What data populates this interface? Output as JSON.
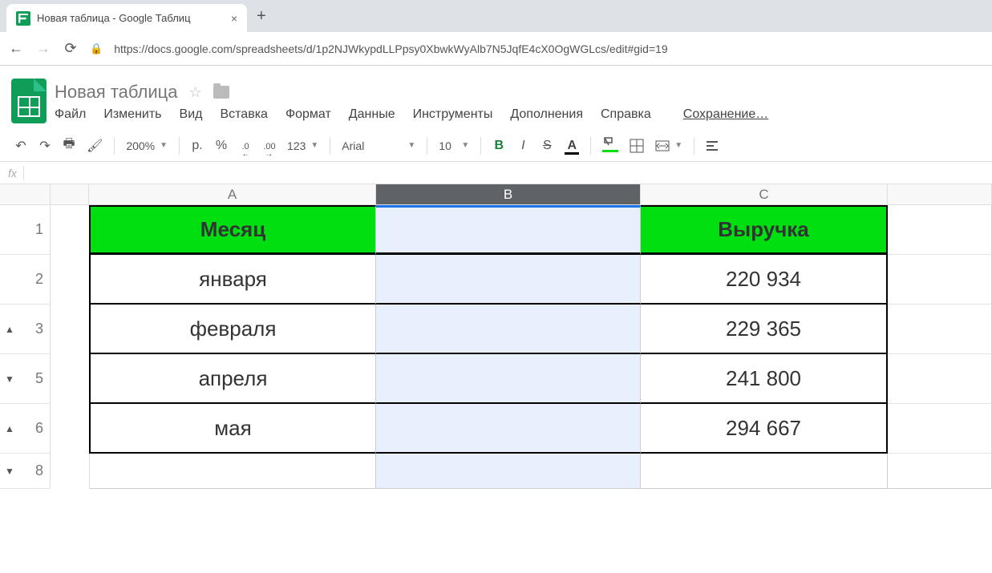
{
  "browser": {
    "tab_title": "Новая таблица - Google Таблиц",
    "url": "https://docs.google.com/spreadsheets/d/1p2NJWkypdLLPpsy0XbwkWyAlb7N5JqfE4cX0OgWGLcs/edit#gid=19"
  },
  "doc": {
    "title": "Новая таблица",
    "status": "Сохранение…"
  },
  "menus": [
    "Файл",
    "Изменить",
    "Вид",
    "Вставка",
    "Формат",
    "Данные",
    "Инструменты",
    "Дополнения",
    "Справка"
  ],
  "toolbar": {
    "zoom": "200%",
    "currency": "р.",
    "percent": "%",
    "dec_dec": ".0",
    "dec_inc": ".00",
    "numfmt": "123",
    "font": "Arial",
    "size": "10",
    "bold": "B",
    "italic": "I",
    "strike": "S",
    "textcolor": "A"
  },
  "columns": [
    "A",
    "B",
    "C"
  ],
  "selected_column": "B",
  "row_numbers": [
    "1",
    "2",
    "3",
    "5",
    "6",
    "8"
  ],
  "row_markers": {
    "r3": "▲",
    "r5": "▼",
    "r6": "▲",
    "r8": "▼"
  },
  "table": {
    "header": {
      "A": "Месяц",
      "B": "",
      "C": "Выручка"
    },
    "rows": [
      {
        "A": "января",
        "B": "",
        "C": "220 934"
      },
      {
        "A": "февраля",
        "B": "",
        "C": "229 365"
      },
      {
        "A": "апреля",
        "B": "",
        "C": "241 800"
      },
      {
        "A": "мая",
        "B": "",
        "C": "294 667"
      }
    ]
  }
}
